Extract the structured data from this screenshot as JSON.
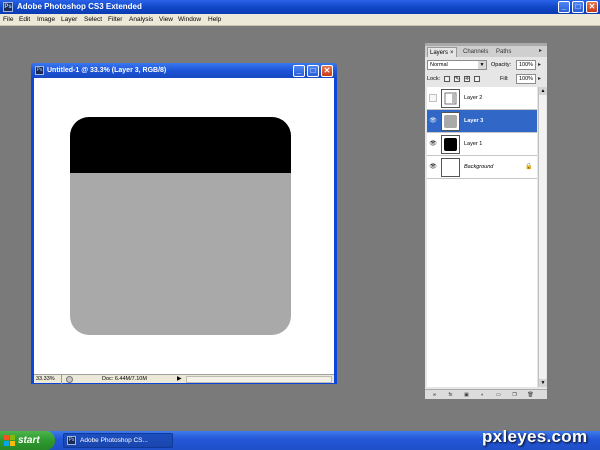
{
  "app": {
    "title": "Adobe Photoshop CS3 Extended",
    "logo_text": "Ps",
    "buttons": {
      "minimize": "_",
      "maximize": "□",
      "close": "✕"
    }
  },
  "menu": [
    "File",
    "Edit",
    "Image",
    "Layer",
    "Select",
    "Filter",
    "Analysis",
    "View",
    "Window",
    "Help"
  ],
  "document": {
    "title": "Untitled-1 @ 33.3% (Layer 3, RGB/8)",
    "zoom": "33.33%",
    "doc_size": "Doc: 6.44M/7.10M",
    "nav_arrow": "▶",
    "buttons": {
      "minimize": "_",
      "maximize": "□",
      "close": "✕"
    },
    "shape_colors": {
      "top": "#000000",
      "body": "#a9a9a9",
      "background": "#ffffff"
    }
  },
  "layers_panel": {
    "tabs": [
      {
        "label": "Layers",
        "close": "×"
      },
      {
        "label": "Channels"
      },
      {
        "label": "Paths"
      }
    ],
    "panel_menu": "▸",
    "blend_mode": "Normal",
    "opacity_label": "Opacity:",
    "opacity_value": "100%",
    "lock_label": "Lock:",
    "fill_label": "Fill:",
    "fill_value": "100%",
    "layers": [
      {
        "name": "Layer 2",
        "visible": false,
        "selected": false
      },
      {
        "name": "Layer 3",
        "visible": true,
        "selected": true
      },
      {
        "name": "Layer 1",
        "visible": true,
        "selected": false
      },
      {
        "name": "Background",
        "visible": true,
        "selected": false
      }
    ],
    "eye_glyph": "👁",
    "lock_glyph": "🔒"
  },
  "taskbar": {
    "start_label": "start",
    "task_label": "Adobe Photoshop CS...",
    "watermark": "pxleyes.com"
  }
}
